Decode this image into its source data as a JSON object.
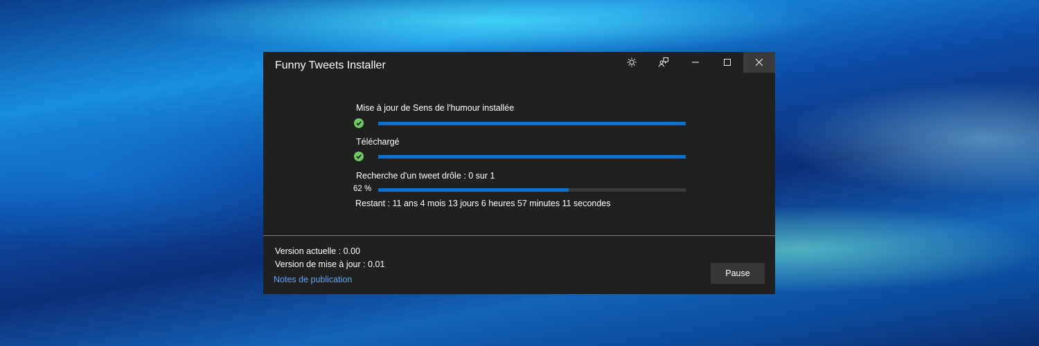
{
  "window": {
    "title": "Funny Tweets Installer",
    "controls": {
      "theme_icon": "sun-icon",
      "feedback_icon": "feedback-icon",
      "minimize_icon": "minimize-icon",
      "maximize_icon": "maximize-icon",
      "close_icon": "close-icon"
    }
  },
  "steps": [
    {
      "label": "Mise à jour de Sens de l'humour installée",
      "status": "done",
      "progress": 1.0
    },
    {
      "label": "Téléchargé",
      "status": "done",
      "progress": 1.0
    },
    {
      "label": "Recherche d'un tweet drôle : 0 sur 1",
      "status": "in-progress",
      "progress": 0.62,
      "percent_text": "62 %"
    }
  ],
  "remaining": "Restant : 11 ans 4 mois 13 jours 6 heures 57 minutes 11 secondes",
  "footer": {
    "current_version": "Version actuelle : 0.00",
    "update_version": "Version de mise à jour : 0.01",
    "release_notes_link": "Notes de publication",
    "pause_label": "Pause"
  },
  "colors": {
    "window_bg": "#202020",
    "accent": "#0f74c8",
    "success": "#6ccb5f",
    "link": "#5aa5ff"
  }
}
